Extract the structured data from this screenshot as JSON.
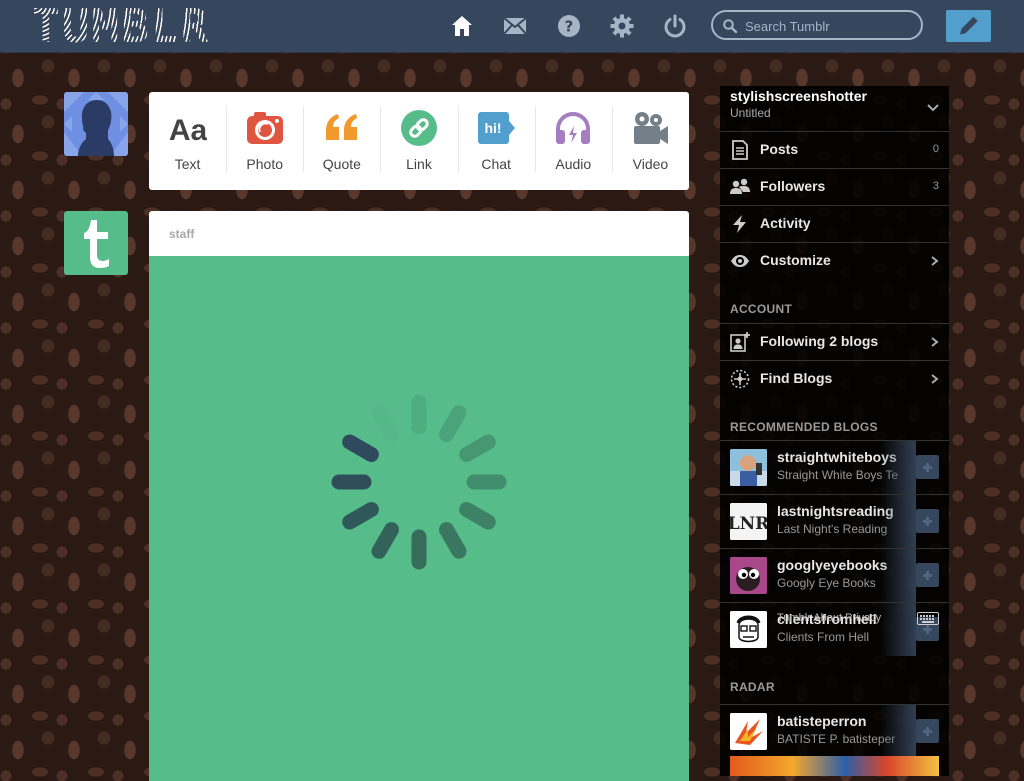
{
  "brand": {
    "logo_text": "TUMBLR"
  },
  "header": {
    "search_placeholder": "Search Tumblr",
    "icons": [
      "home-icon",
      "mail-icon",
      "help-icon",
      "gear-icon",
      "power-icon",
      "search-icon",
      "pencil-icon"
    ]
  },
  "colors": {
    "header": "#36465d",
    "compose": "#529ecc",
    "post": "#56bc8a",
    "photo": "#e0553f",
    "quote": "#f2992e",
    "link": "#56bc8a",
    "chat": "#529ecc",
    "audio": "#a77dc2",
    "video": "#748089"
  },
  "composer": {
    "types": [
      {
        "label": "Text",
        "icon": "text-icon"
      },
      {
        "label": "Photo",
        "icon": "camera-icon"
      },
      {
        "label": "Quote",
        "icon": "quote-icon"
      },
      {
        "label": "Link",
        "icon": "link-icon"
      },
      {
        "label": "Chat",
        "icon": "chat-icon"
      },
      {
        "label": "Audio",
        "icon": "headphones-icon"
      },
      {
        "label": "Video",
        "icon": "video-camera-icon"
      }
    ]
  },
  "post": {
    "author": "staff",
    "status": "loading"
  },
  "sidebar": {
    "account": {
      "name": "stylishscreenshotter",
      "subtitle": "Untitled"
    },
    "items": [
      {
        "label": "Posts",
        "count": "0",
        "icon": "posts-icon"
      },
      {
        "label": "Followers",
        "count": "3",
        "icon": "followers-icon"
      },
      {
        "label": "Activity",
        "icon": "lightning-icon"
      },
      {
        "label": "Customize",
        "icon": "eye-icon"
      }
    ],
    "account_heading": "ACCOUNT",
    "account_items": [
      {
        "label": "Following 2 blogs",
        "icon": "following-icon"
      },
      {
        "label": "Find Blogs",
        "icon": "compass-icon"
      }
    ],
    "recommended_heading": "RECOMMENDED BLOGS",
    "recommended": [
      {
        "name": "straightwhiteboys",
        "desc": "Straight White Boys Te"
      },
      {
        "name": "lastnightsreading",
        "desc": "Last Night's Reading"
      },
      {
        "name": "googlyeyebooks",
        "desc": "Googly Eye Books"
      },
      {
        "name": "clientsfromhell",
        "desc": "Clients From Hell"
      }
    ],
    "footer": {
      "links_text": "Tumblr  About  Privacy"
    },
    "radar_heading": "RADAR",
    "radar": {
      "name": "batisteperron",
      "desc": "BATISTE P. batisteper"
    }
  }
}
